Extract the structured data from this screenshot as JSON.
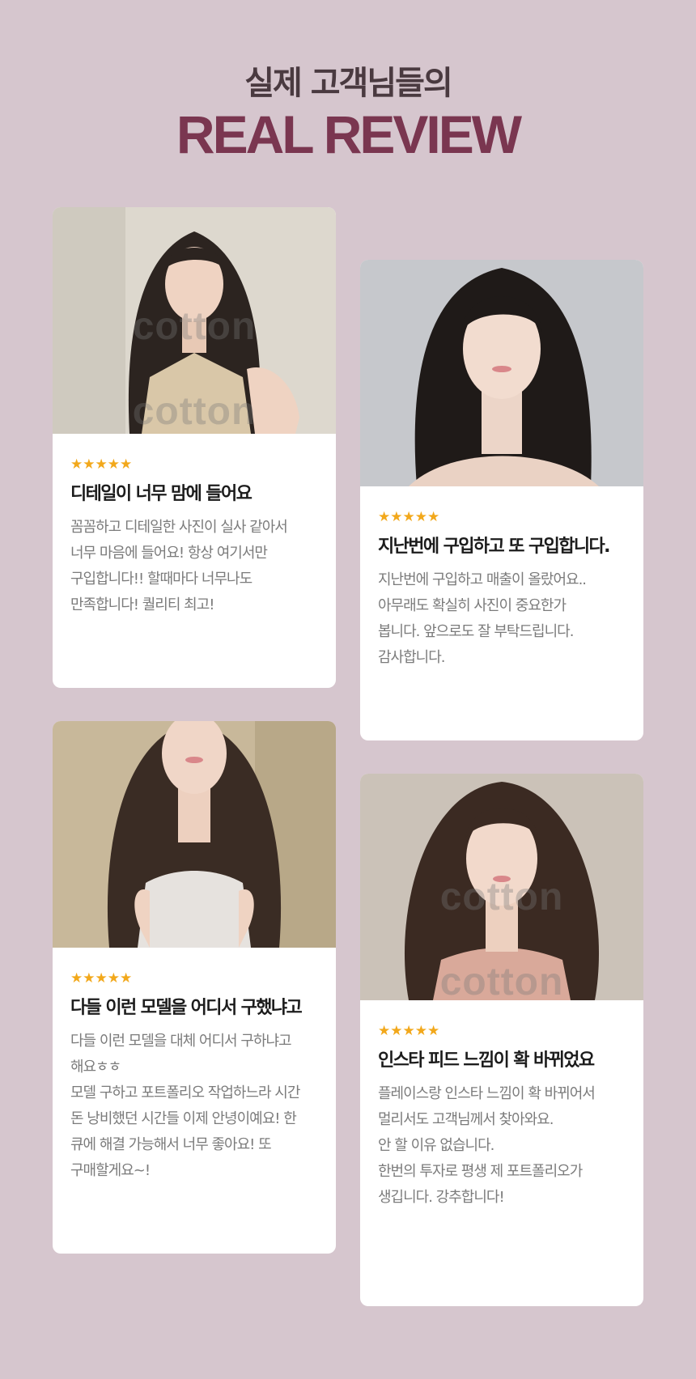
{
  "header": {
    "subtitle": "실제 고객님들의",
    "title": "REAL REVIEW"
  },
  "colors": {
    "background": "#d6c6ce",
    "title": "#7a3650",
    "subtitle": "#4a3a40",
    "stars": "#f2a81b"
  },
  "reviews": [
    {
      "photo_watermark": "cotton",
      "stars": "★★★★★",
      "title": "디테일이 너무 맘에 들어요",
      "text": "꼼꼼하고 디테일한 사진이 실사 같아서\n너무 마음에 들어요! 항상 여기서만\n구입합니다!! 할때마다 너무나도\n만족합니다! 퀄리티 최고!"
    },
    {
      "photo_watermark": "",
      "stars": "★★★★★",
      "title": "지난번에 구입하고 또 구입합니다.",
      "text": "지난번에 구입하고 매출이 올랐어요..\n아무래도 확실히 사진이 중요한가\n봅니다. 앞으로도 잘 부탁드립니다.\n감사합니다."
    },
    {
      "photo_watermark": "",
      "stars": "★★★★★",
      "title": "다들 이런 모델을 어디서 구했냐고",
      "text": "다들 이런 모델을 대체 어디서 구하냐고\n해요ㅎㅎ\n모델 구하고 포트폴리오 작업하느라 시간\n돈 낭비했던 시간들 이제 안녕이예요! 한\n큐에 해결 가능해서 너무 좋아요! 또\n구매할게요~!"
    },
    {
      "photo_watermark": "cotton",
      "stars": "★★★★★",
      "title": "인스타 피드 느낌이 확 바뀌었요",
      "text": "플레이스랑 인스타 느낌이 확 바뀌어서\n멀리서도 고객님께서 찾아와요.\n안 할 이유 없습니다.\n한번의 투자로 평생 제 포트폴리오가\n생깁니다. 강추합니다!"
    }
  ]
}
